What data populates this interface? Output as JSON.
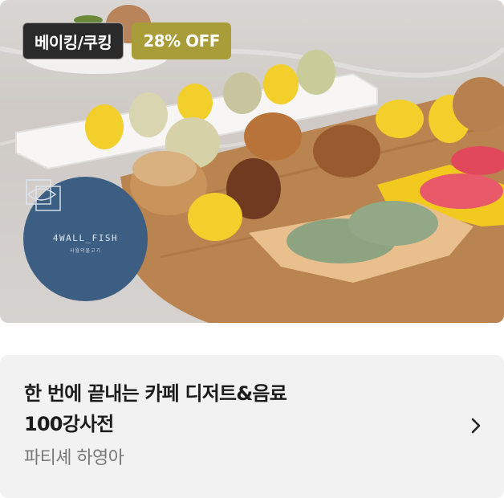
{
  "card": {
    "badges": {
      "category": "베이킹/쿠킹",
      "discount": "28% OFF"
    },
    "brand": {
      "wordmark": "4WALL_FISH",
      "sub": "사월의물고기"
    },
    "title_line1": "한 번에 끝내는 카페 디저트&음료",
    "title_line2": "100강사전",
    "author": "파티셰 하영아",
    "icons": {
      "chevron": "chevron-right-icon",
      "logo": "brand-logo-mark"
    },
    "colors": {
      "category_badge": "#2a2a2a",
      "discount_badge": "#a89d38",
      "logo_circle": "#3d5e83",
      "panel_bg": "#f2f2f2"
    }
  }
}
